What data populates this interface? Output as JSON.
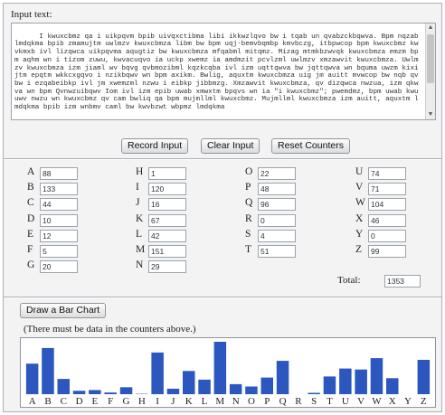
{
  "input": {
    "label": "Input text:",
    "text": "I kwuxcbmz qa i uikpqvm bpib uivqxctibma libi ikkwzlqvo bw i tqab un qvabzckbqwva. Bpm nqzab lmdqkma bpib zmamujtm uwlmzv kwuxcbmza libm bw bpm uqj-bemvbqmbp kmvbczg, itbpwcop bpm kwuxcbmz kwvkmxb ivl lizqwca uikpqvma aqugtiz bw kwuxcbmza mfqabml mitqmz. Mizag mtmkbzwvqk kwuxcbmza emzm bpm aqhm wn i tizom zuwu, kwvacuqvo ia uckp xwemz ia amdmzit pcvlzml uwlmzv xmzawvit kwuxcbmza. Uwlmzv kwuxcbmza izm jiaml wv bqvg qvbmozibml kqzkcqba ivl izm uqttqwva bw jqttqwva wn bquma uwzm kixijtm epqtm wkkcxgqvo i nzikbqwv wn bpm axikm. Bwlig, aquxtm kwuxcbmza uig jm auitt mvwcop bw nqb qvbw i ezqabeibkp ivl jm xwemzml nzwu i eibkp jibbmzg. Xmzawvit kwuxcbmza, qv dizqwca nwzua, izm qkwva wn bpm Qvnwzuibqwv Iom ivl izm epib uwab xmwxtm bpqvs wn ia \"i kwuxcbmz\"; pwemdmz, bpm uwab kwuuwv nwzu wn kwuxcbmz qv cam bwliq qa bpm mujmllml kwuxcbmz. Mujmllml kwuxcbmza izm auitt, aquxtm lmdqkma bpib izm wnbmv caml bw kwvbzwt wbpmz lmdqkma"
  },
  "buttons": {
    "record": "Record Input",
    "clear": "Clear Input",
    "reset": "Reset Counters",
    "draw": "Draw a Bar Chart"
  },
  "counters": [
    {
      "letter": "A",
      "value": "88"
    },
    {
      "letter": "B",
      "value": "133"
    },
    {
      "letter": "C",
      "value": "44"
    },
    {
      "letter": "D",
      "value": "10"
    },
    {
      "letter": "E",
      "value": "12"
    },
    {
      "letter": "F",
      "value": "5"
    },
    {
      "letter": "G",
      "value": "20"
    },
    {
      "letter": "H",
      "value": "1"
    },
    {
      "letter": "I",
      "value": "120"
    },
    {
      "letter": "J",
      "value": "16"
    },
    {
      "letter": "K",
      "value": "67"
    },
    {
      "letter": "L",
      "value": "42"
    },
    {
      "letter": "M",
      "value": "151"
    },
    {
      "letter": "N",
      "value": "29"
    },
    {
      "letter": "O",
      "value": "22"
    },
    {
      "letter": "P",
      "value": "48"
    },
    {
      "letter": "Q",
      "value": "96"
    },
    {
      "letter": "R",
      "value": "0"
    },
    {
      "letter": "S",
      "value": "4"
    },
    {
      "letter": "T",
      "value": "51"
    },
    {
      "letter": "U",
      "value": "74"
    },
    {
      "letter": "V",
      "value": "71"
    },
    {
      "letter": "W",
      "value": "104"
    },
    {
      "letter": "X",
      "value": "46"
    },
    {
      "letter": "Y",
      "value": "0"
    },
    {
      "letter": "Z",
      "value": "99"
    }
  ],
  "total": {
    "label": "Total:",
    "value": "1353"
  },
  "chart_note": "(There must be data in the counters above.)",
  "colors": {
    "bar": "#2b57bf",
    "panel": "#f3f3f3",
    "border": "#aab0b8"
  },
  "chart_data": {
    "type": "bar",
    "categories": [
      "A",
      "B",
      "C",
      "D",
      "E",
      "F",
      "G",
      "H",
      "I",
      "J",
      "K",
      "L",
      "M",
      "N",
      "O",
      "P",
      "Q",
      "R",
      "S",
      "T",
      "U",
      "V",
      "W",
      "X",
      "Y",
      "Z"
    ],
    "values": [
      88,
      133,
      44,
      10,
      12,
      5,
      20,
      1,
      120,
      16,
      67,
      42,
      151,
      29,
      22,
      48,
      96,
      0,
      4,
      51,
      74,
      71,
      104,
      46,
      0,
      99
    ],
    "title": "",
    "xlabel": "",
    "ylabel": "",
    "ylim": [
      0,
      151
    ],
    "grid": false
  }
}
